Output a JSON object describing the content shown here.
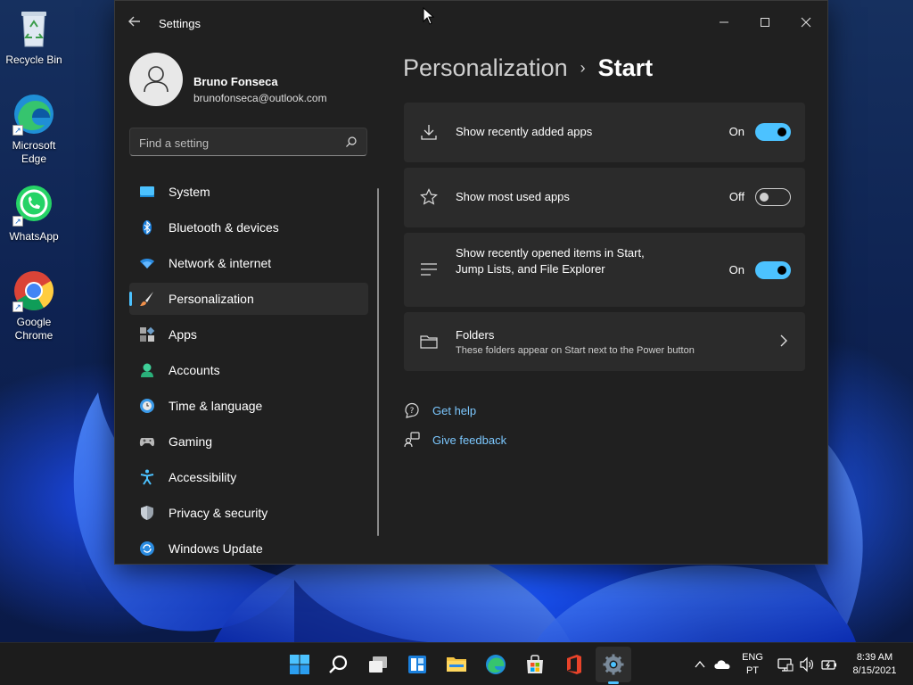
{
  "desktop": {
    "icons": [
      {
        "label": "Recycle Bin",
        "icon": "recycle-bin-icon"
      },
      {
        "label": "Microsoft Edge",
        "icon": "edge-icon"
      },
      {
        "label": "WhatsApp",
        "icon": "whatsapp-icon"
      },
      {
        "label": "Google Chrome",
        "icon": "chrome-icon"
      }
    ]
  },
  "window": {
    "title": "Settings",
    "controls": [
      "minimize",
      "maximize",
      "close"
    ]
  },
  "profile": {
    "name": "Bruno Fonseca",
    "email": "brunofonseca@outlook.com"
  },
  "search": {
    "placeholder": "Find a setting"
  },
  "nav": {
    "items": [
      {
        "label": "System",
        "icon": "system-icon"
      },
      {
        "label": "Bluetooth & devices",
        "icon": "bluetooth-icon"
      },
      {
        "label": "Network & internet",
        "icon": "wifi-icon"
      },
      {
        "label": "Personalization",
        "icon": "brush-icon",
        "active": true
      },
      {
        "label": "Apps",
        "icon": "apps-icon"
      },
      {
        "label": "Accounts",
        "icon": "account-icon"
      },
      {
        "label": "Time & language",
        "icon": "clock-globe-icon"
      },
      {
        "label": "Gaming",
        "icon": "gamepad-icon"
      },
      {
        "label": "Accessibility",
        "icon": "accessibility-icon"
      },
      {
        "label": "Privacy & security",
        "icon": "shield-icon"
      },
      {
        "label": "Windows Update",
        "icon": "update-icon"
      }
    ]
  },
  "breadcrumb": {
    "parent": "Personalization",
    "separator": "›",
    "current": "Start"
  },
  "settings": [
    {
      "title": "Show recently added apps",
      "state": "On",
      "enabled": true,
      "icon": "download-icon"
    },
    {
      "title": "Show most used apps",
      "state": "Off",
      "enabled": false,
      "icon": "star-icon"
    },
    {
      "title": "Show recently opened items in Start, Jump Lists, and File Explorer",
      "state": "On",
      "enabled": true,
      "icon": "list-icon"
    }
  ],
  "folders": {
    "title": "Folders",
    "description": "These folders appear on Start next to the Power button",
    "icon": "folder-icon"
  },
  "links": {
    "help": "Get help",
    "feedback": "Give feedback"
  },
  "taskbar": {
    "apps": [
      "start-icon",
      "search-icon",
      "task-view-icon",
      "widgets-icon",
      "file-explorer-icon",
      "edge-icon",
      "store-icon",
      "office-icon",
      "settings-icon"
    ],
    "language_top": "ENG",
    "language_bottom": "PT",
    "time": "8:39 AM",
    "date": "8/15/2021"
  },
  "colors": {
    "accent": "#4cc2ff",
    "window_bg": "#202020",
    "card_bg": "#2b2b2b",
    "link": "#7cc8ff"
  }
}
